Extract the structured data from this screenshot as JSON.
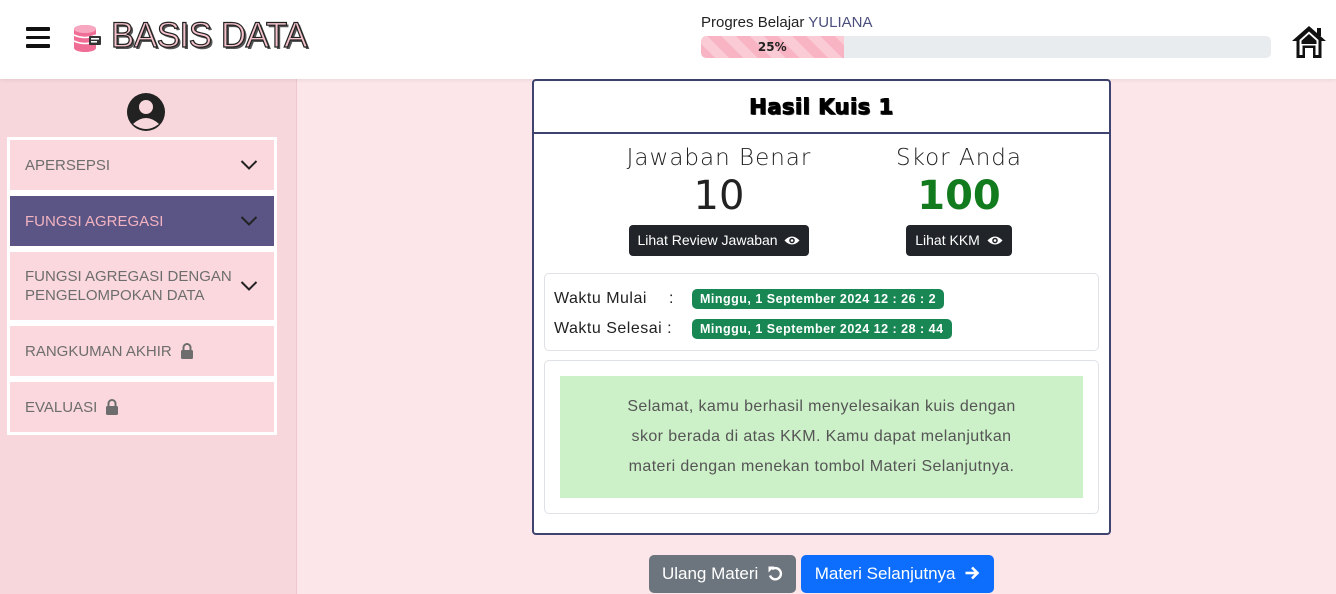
{
  "header": {
    "brand": "BASIS DATA",
    "progress_label": "Progres Belajar",
    "user_name": "YULIANA",
    "progress_text": "25%",
    "progress_value": 0.25
  },
  "sidebar": {
    "items": [
      {
        "label": "APERSEPSI",
        "active": false,
        "icon": "chevron-down-icon"
      },
      {
        "label": "FUNGSI AGREGASI",
        "active": true,
        "icon": "chevron-down-icon"
      },
      {
        "label": "FUNGSI AGREGASI DENGAN PENGELOMPOKAN DATA",
        "active": false,
        "icon": "chevron-down-icon"
      },
      {
        "label": "RANGKUMAN AKHIR",
        "active": false,
        "icon": "lock-icon"
      },
      {
        "label": "EVALUASI",
        "active": false,
        "icon": "lock-icon"
      }
    ]
  },
  "result": {
    "title": "Hasil Kuis 1",
    "correct_label": "Jawaban Benar",
    "correct_value": "10",
    "score_label": "Skor Anda",
    "score_value": "100",
    "review_button": "Lihat Review Jawaban",
    "kkm_button": "Lihat KKM",
    "start_label": "Waktu Mulai",
    "start_sep": ":",
    "start_value": "Minggu, 1 September 2024 12 : 26 : 2",
    "end_label": "Waktu Selesai",
    "end_sep": ":",
    "end_value": "Minggu, 1 September 2024 12 : 28 : 44",
    "message_lines": [
      "Selamat, kamu berhasil menyelesaikan kuis dengan",
      "skor berada di atas KKM. Kamu dapat melanjutkan",
      "materi dengan menekan tombol Materi Selanjutnya."
    ]
  },
  "actions": {
    "repeat_label": "Ulang Materi",
    "next_label": "Materi Selanjutnya"
  },
  "colors": {
    "sidebar_active_bg": "#5a5585",
    "score_green": "#127b1e",
    "badge_green": "#198754",
    "next_blue": "#0d6efd",
    "repeat_gray": "#6c757d"
  }
}
